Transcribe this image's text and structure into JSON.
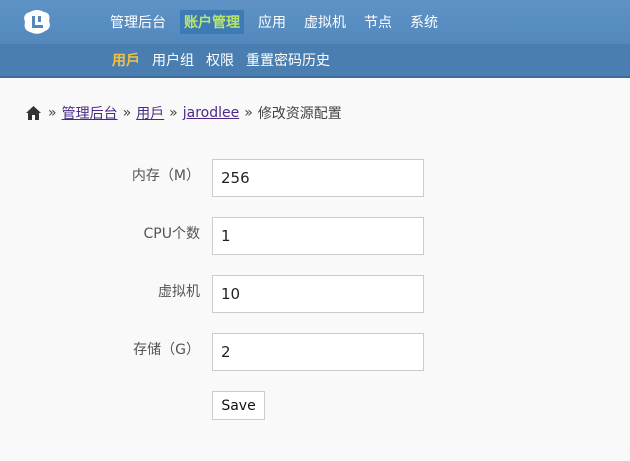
{
  "brand": {
    "logo_icon": "cloud-logo-icon"
  },
  "main_nav": [
    {
      "label": "管理后台",
      "active": false
    },
    {
      "label": "账户管理",
      "active": true
    },
    {
      "label": "应用",
      "active": false
    },
    {
      "label": "虚拟机",
      "active": false
    },
    {
      "label": "节点",
      "active": false
    },
    {
      "label": "系统",
      "active": false
    }
  ],
  "sub_nav": [
    {
      "label": "用戶",
      "active": true
    },
    {
      "label": "用户组",
      "active": false
    },
    {
      "label": "权限",
      "active": false
    },
    {
      "label": "重置密码历史",
      "active": false
    }
  ],
  "breadcrumb": {
    "home_icon": "home-icon",
    "separator": "»",
    "links": [
      "管理后台",
      "用戶",
      "jarodlee"
    ],
    "current": "修改资源配置"
  },
  "form": {
    "fields": [
      {
        "label": "内存（M）",
        "value": "256"
      },
      {
        "label": "CPU个数",
        "value": "1"
      },
      {
        "label": "虚拟机",
        "value": "10"
      },
      {
        "label": "存储（G）",
        "value": "2"
      }
    ],
    "save_label": "Save"
  },
  "colors": {
    "topbar": "#5288bd",
    "subbar": "#4a7eb1",
    "active_main": "#b8e66b",
    "active_sub": "#f4c23d",
    "link": "#4b2a86"
  }
}
